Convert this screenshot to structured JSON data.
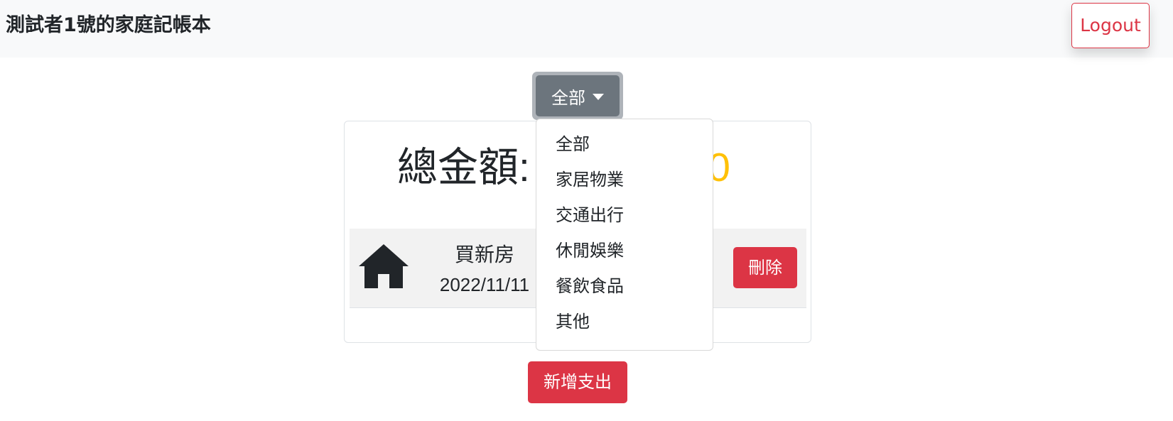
{
  "navbar": {
    "title": "測試者1號的家庭記帳本",
    "logout_label": "Logout"
  },
  "filter": {
    "selected": "全部",
    "options": [
      "全部",
      "家居物業",
      "交通出行",
      "休閒娛樂",
      "餐飲食品",
      "其他"
    ]
  },
  "summary": {
    "total_label": "總金額:",
    "total_amount": "$",
    "total_amount_tail": "00"
  },
  "records": [
    {
      "name": "買新房",
      "date": "2022/11/11",
      "icon": "house-icon",
      "delete_label": "刪除"
    }
  ],
  "actions": {
    "add_label": "新增支出"
  },
  "colors": {
    "accent_amount": "#ffc107",
    "danger": "#dc3545",
    "primary": "#0d6efd",
    "secondary": "#6c757d"
  }
}
